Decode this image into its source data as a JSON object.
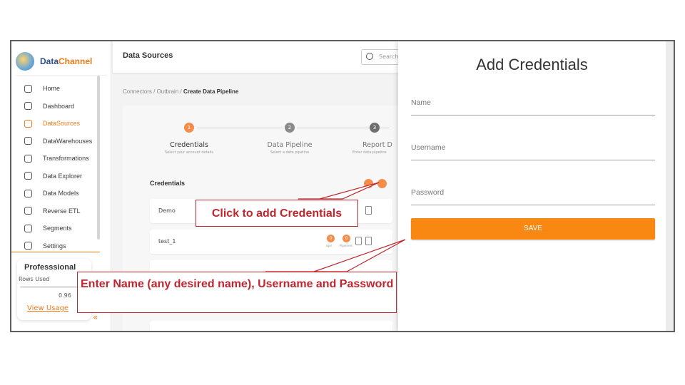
{
  "brand": {
    "name_part1": "Data",
    "name_part2": "Channel"
  },
  "sidebar": {
    "items": [
      {
        "label": "Home",
        "icon": "home-icon"
      },
      {
        "label": "Dashboard",
        "icon": "dashboard-icon"
      },
      {
        "label": "DataSources",
        "icon": "datasources-icon",
        "active": true
      },
      {
        "label": "DataWarehouses",
        "icon": "datawarehouses-icon"
      },
      {
        "label": "Transformations",
        "icon": "transformations-icon"
      },
      {
        "label": "Data Explorer",
        "icon": "data-explorer-icon"
      },
      {
        "label": "Data Models",
        "icon": "data-models-icon"
      },
      {
        "label": "Reverse ETL",
        "icon": "reverse-etl-icon"
      },
      {
        "label": "Segments",
        "icon": "segments-icon"
      },
      {
        "label": "Settings",
        "icon": "settings-icon"
      }
    ],
    "plan": {
      "name": "Professsional",
      "rows_label": "Rows Used",
      "rows_value": "0.96",
      "link": "View Usage"
    },
    "collapse_glyph": "«"
  },
  "header": {
    "title": "Data Sources",
    "search_placeholder": "Search"
  },
  "breadcrumb": {
    "part1": "Connectors / Outbrain / ",
    "current": "Create Data Pipeline"
  },
  "steps": [
    {
      "num": "1",
      "label": "Credentials",
      "sub": "Select your account details"
    },
    {
      "num": "2",
      "label": "Data Pipeline",
      "sub": "Select a data pipeline"
    },
    {
      "num": "3",
      "label": "Report D",
      "sub": "Enter data pipeline"
    }
  ],
  "credentials": {
    "heading": "Credentials",
    "rows": [
      {
        "name": "Demo"
      },
      {
        "name": "test_1",
        "badge1": "0",
        "badge1_label": "apis",
        "badge2": "0",
        "badge2_label": "Pipelines"
      }
    ]
  },
  "drawer": {
    "title": "Add Credentials",
    "fields": {
      "name": "Name",
      "username": "Username",
      "password": "Password"
    },
    "save_label": "SAVE"
  },
  "callouts": {
    "add": "Click to add Credentials",
    "enter": "Enter Name (any desired name), Username and Password"
  },
  "colors": {
    "accent": "#f07a1a",
    "save": "#f98812",
    "callout": "#c0262e"
  }
}
